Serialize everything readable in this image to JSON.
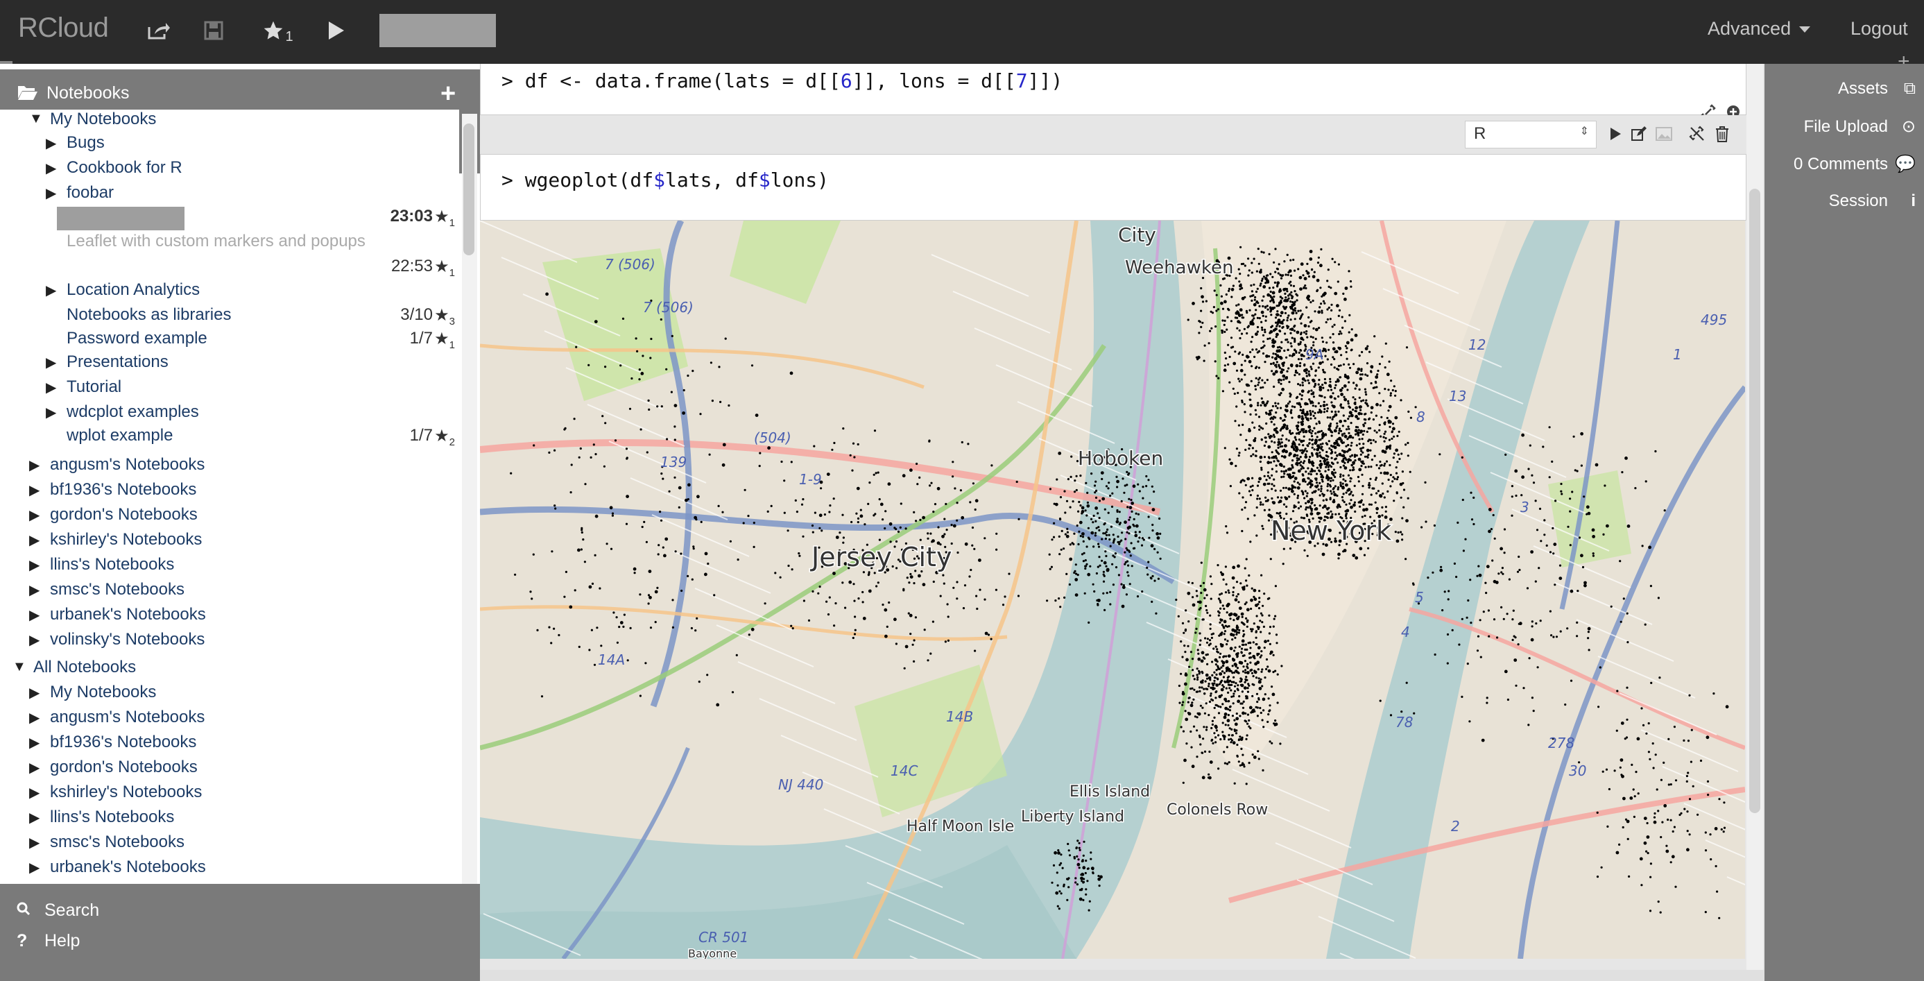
{
  "app": {
    "brand": "RCloud"
  },
  "toolbar": {
    "star_count": "1"
  },
  "nav": {
    "advanced": "Advanced",
    "logout": "Logout"
  },
  "left": {
    "header": "Notebooks",
    "tree": [
      {
        "label": "My Notebooks",
        "level": 1,
        "tri": "▼"
      },
      {
        "label": "Bugs",
        "level": 2,
        "tri": "▶"
      },
      {
        "label": "Cookbook for R",
        "level": 2,
        "tri": "▶"
      },
      {
        "label": "foobar",
        "level": 2,
        "tri": "▶"
      },
      {
        "label": "",
        "level": 2,
        "date": "23:03",
        "star": "1",
        "highlight": true
      },
      {
        "label": "Leaflet with custom markers and popups",
        "level": 2,
        "gray": true
      },
      {
        "label": "",
        "level": 2,
        "date": "22:53",
        "star": "1"
      },
      {
        "label": "Location Analytics",
        "level": 2,
        "tri": "▶"
      },
      {
        "label": "Notebooks as libraries",
        "level": 2,
        "date": "3/10",
        "star": "3"
      },
      {
        "label": "Password example",
        "level": 2,
        "date": "1/7",
        "star": "1"
      },
      {
        "label": "Presentations",
        "level": 2,
        "tri": "▶"
      },
      {
        "label": "Tutorial",
        "level": 2,
        "tri": "▶"
      },
      {
        "label": "wdcplot examples",
        "level": 2,
        "tri": "▶"
      },
      {
        "label": "wplot example",
        "level": 2,
        "date": "1/7",
        "star": "2"
      },
      {
        "label": "angusm's Notebooks",
        "level": 1,
        "tri": "▶"
      },
      {
        "label": "bf1936's Notebooks",
        "level": 1,
        "tri": "▶"
      },
      {
        "label": "gordon's Notebooks",
        "level": 1,
        "tri": "▶"
      },
      {
        "label": "kshirley's Notebooks",
        "level": 1,
        "tri": "▶"
      },
      {
        "label": "llins's Notebooks",
        "level": 1,
        "tri": "▶"
      },
      {
        "label": "smsc's Notebooks",
        "level": 1,
        "tri": "▶"
      },
      {
        "label": "urbanek's Notebooks",
        "level": 1,
        "tri": "▶"
      },
      {
        "label": "volinsky's Notebooks",
        "level": 1,
        "tri": "▶"
      },
      {
        "label": "All Notebooks",
        "level": 0,
        "tri": "▼"
      },
      {
        "label": "My Notebooks",
        "level": 1,
        "tri": "▶"
      },
      {
        "label": "angusm's Notebooks",
        "level": 1,
        "tri": "▶"
      },
      {
        "label": "bf1936's Notebooks",
        "level": 1,
        "tri": "▶"
      },
      {
        "label": "gordon's Notebooks",
        "level": 1,
        "tri": "▶"
      },
      {
        "label": "kshirley's Notebooks",
        "level": 1,
        "tri": "▶"
      },
      {
        "label": "llins's Notebooks",
        "level": 1,
        "tri": "▶"
      },
      {
        "label": "smsc's Notebooks",
        "level": 1,
        "tri": "▶"
      },
      {
        "label": "urbanek's Notebooks",
        "level": 1,
        "tri": "▶"
      },
      {
        "label": "volinsky's Notebooks",
        "level": 1,
        "tri": "▶"
      }
    ],
    "footer": {
      "search": "Search",
      "help": "Help"
    }
  },
  "cells": {
    "cell1_code": {
      "prompt": ">",
      "a": "df <- data.frame(lats = d[[",
      "n1": "6",
      "b": "]], lons = d[[",
      "n2": "7",
      "c": "]])"
    },
    "cell2_code": {
      "prompt": ">",
      "a": "wgeoplot(df",
      "d1": "$",
      "b": "lats, df",
      "d2": "$",
      "c": "lons)"
    },
    "language": "R"
  },
  "map": {
    "labels": [
      "City",
      "Weehawken",
      "Hoboken",
      "Jersey City",
      "New York",
      "Ellis Island",
      "Liberty Island",
      "Colonels Row",
      "Half Moon Isle",
      "Bayonne"
    ],
    "route_labels": [
      "7 (506)",
      "7 (506)",
      "(504)",
      "139",
      "1-9",
      "NJ 440",
      "CR 501",
      "14B",
      "14C",
      "14A",
      "78",
      "9A",
      "495",
      "278",
      "30",
      "12",
      "13",
      "3",
      "5",
      "4",
      "2",
      "1",
      "8"
    ]
  },
  "right": {
    "assets": "Assets",
    "file_upload": "File Upload",
    "comments": "0 Comments",
    "session": "Session"
  },
  "colors": {
    "topbar": "#2b2b2b",
    "sidepanel": "#7a7a7a",
    "link": "#1d3c66",
    "water": "#b5d0d0",
    "park": "#c8e6a0"
  }
}
